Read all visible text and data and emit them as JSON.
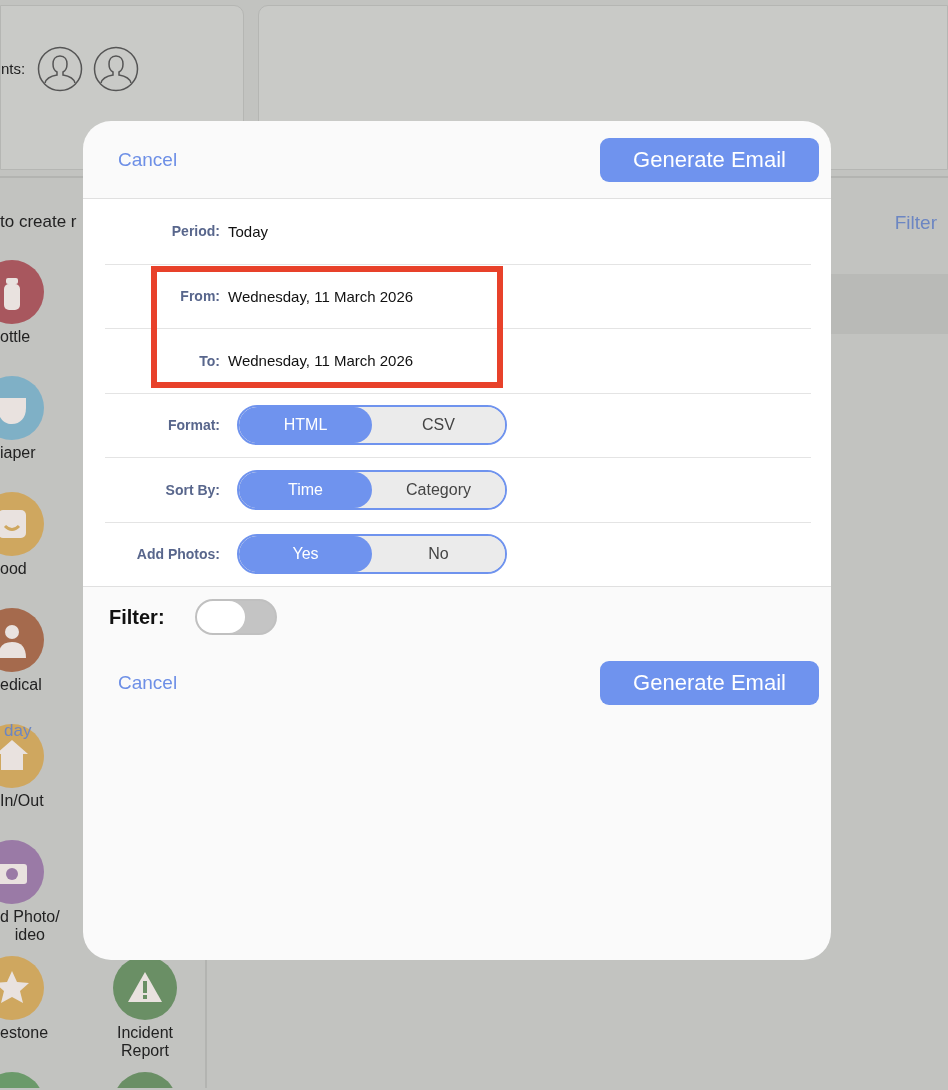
{
  "background": {
    "participants_label": "nts:",
    "avatars": [
      {
        "kind": "person"
      },
      {
        "kind": "person"
      }
    ],
    "activities_hint": "to create r",
    "day_link": "day",
    "filter_link": "Filter",
    "activities_left": [
      {
        "kind": "bottle",
        "label": "ottle",
        "color": "#a8575e"
      },
      {
        "kind": "diaper",
        "label": "iaper",
        "color": "#7fb0c6"
      },
      {
        "kind": "mood",
        "label": "ood",
        "color": "#cfa75f"
      },
      {
        "kind": "medical",
        "label": "edical",
        "color": "#a56a4d"
      },
      {
        "kind": "house",
        "label": "In/Out",
        "color": "#cfa75f"
      },
      {
        "kind": "camera",
        "label": "d Photo/\nideo",
        "color": "#9a7aa6"
      },
      {
        "kind": "star",
        "label": "estone",
        "color": "#cfa75f"
      },
      {
        "kind": "blank",
        "color": "#6b9a6a"
      }
    ],
    "activities_right": [
      {
        "kind": "warning",
        "label": "Incident Report",
        "color": "#6a8f65"
      },
      {
        "kind": "blank",
        "color": "#6a8f65"
      }
    ]
  },
  "modal": {
    "cancel": "Cancel",
    "generate": "Generate Email",
    "rows": [
      {
        "kind": "text",
        "label": "Period:",
        "value": "Today"
      },
      {
        "kind": "text",
        "label": "From:",
        "value": "Wednesday, 11 March 2026"
      },
      {
        "kind": "text",
        "label": "To:",
        "value": "Wednesday, 11 March 2026"
      },
      {
        "kind": "segmented",
        "label": "Format:",
        "options": [
          {
            "label": "HTML",
            "selected": true
          },
          {
            "label": "CSV",
            "selected": false
          }
        ]
      },
      {
        "kind": "segmented",
        "label": "Sort By:",
        "options": [
          {
            "label": "Time",
            "selected": true
          },
          {
            "label": "Category",
            "selected": false
          }
        ]
      },
      {
        "kind": "segmented",
        "label": "Add Photos:",
        "options": [
          {
            "label": "Yes",
            "selected": true
          },
          {
            "label": "No",
            "selected": false
          }
        ]
      }
    ],
    "filter": {
      "label": "Filter:",
      "on": false
    },
    "bottom_cancel": "Cancel",
    "bottom_generate": "Generate Email"
  }
}
